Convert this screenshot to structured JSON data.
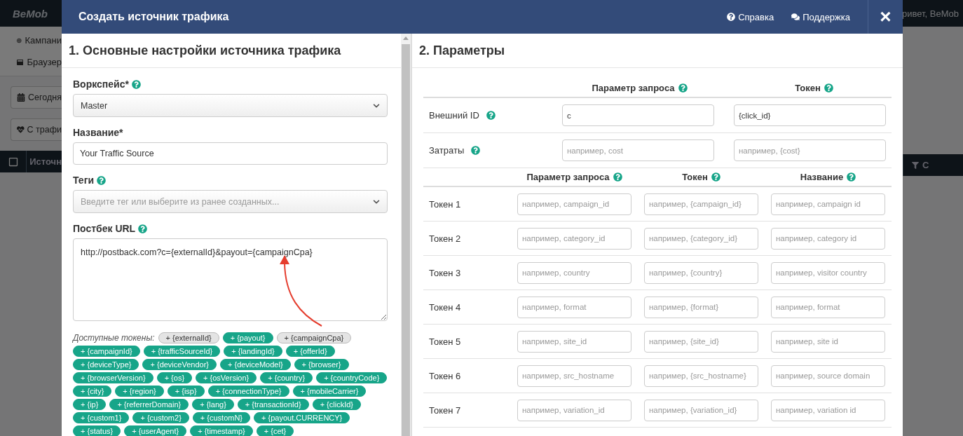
{
  "background": {
    "logo": "BeMob",
    "greeting": "ривет, BeMob",
    "nav": [
      {
        "kind": "campaigns",
        "label": "Кампани"
      },
      {
        "kind": "browser",
        "label": "Браузер"
      }
    ],
    "filters": [
      {
        "kind": "date",
        "label": "Сегодня"
      },
      {
        "kind": "traffic",
        "label": "С трафи"
      }
    ],
    "table_header": {
      "column_1": "Источн",
      "column_2": "C"
    }
  },
  "modal": {
    "title": "Создать источник трафика",
    "links": [
      {
        "kind": "help",
        "label": "Справка"
      },
      {
        "kind": "support",
        "label": "Поддержка"
      }
    ],
    "close": "×"
  },
  "section_1": {
    "heading": "1. Основные настройки источника трафика",
    "workspace": {
      "label": "Воркспейс*",
      "value": "Master"
    },
    "name": {
      "label": "Название*",
      "value": "Your Traffic Source"
    },
    "tags": {
      "label": "Теги",
      "placeholder": "Введите тег или выберите из ранее созданных..."
    },
    "postback": {
      "label": "Постбек URL",
      "value": "http://postback.com?c={externalId}&payout={campaignCpa}"
    },
    "tokens_label": "Доступные токены:",
    "tokens": [
      {
        "label": "+ {externalId}",
        "used": true
      },
      {
        "label": "+ {payout}",
        "used": false
      },
      {
        "label": "+ {campaignCpa}",
        "used": true
      },
      {
        "label": "+ {campaignId}",
        "used": false
      },
      {
        "label": "+ {trafficSourceId}",
        "used": false
      },
      {
        "label": "+ {landingId}",
        "used": false
      },
      {
        "label": "+ {offerId}",
        "used": false
      },
      {
        "label": "+ {deviceType}",
        "used": false
      },
      {
        "label": "+ {deviceVendor}",
        "used": false
      },
      {
        "label": "+ {deviceModel}",
        "used": false
      },
      {
        "label": "+ {browser}",
        "used": false
      },
      {
        "label": "+ {browserVersion}",
        "used": false
      },
      {
        "label": "+ {os}",
        "used": false
      },
      {
        "label": "+ {osVersion}",
        "used": false
      },
      {
        "label": "+ {country}",
        "used": false
      },
      {
        "label": "+ {countryCode}",
        "used": false
      },
      {
        "label": "+ {city}",
        "used": false
      },
      {
        "label": "+ {region}",
        "used": false
      },
      {
        "label": "+ {isp}",
        "used": false
      },
      {
        "label": "+ {connectionType}",
        "used": false
      },
      {
        "label": "+ {mobileCarrier}",
        "used": false
      },
      {
        "label": "+ {ip}",
        "used": false
      },
      {
        "label": "+ {referrerDomain}",
        "used": false
      },
      {
        "label": "+ {lang}",
        "used": false
      },
      {
        "label": "+ {transactionId}",
        "used": false
      },
      {
        "label": "+ {clickId}",
        "used": false
      },
      {
        "label": "+ {custom1}",
        "used": false
      },
      {
        "label": "+ {custom2}",
        "used": false
      },
      {
        "label": "+ {customN}",
        "used": false
      },
      {
        "label": "+ {payout.CURRENCY}",
        "used": false
      },
      {
        "label": "+ {status}",
        "used": false
      },
      {
        "label": "+ {userAgent}",
        "used": false
      },
      {
        "label": "+ {timestamp}",
        "used": false
      },
      {
        "label": "+ {cet}",
        "used": false
      }
    ]
  },
  "section_2": {
    "heading": "2. Параметры",
    "main_columns": [
      "Параметр запроса",
      "Токен"
    ],
    "main_rows": [
      {
        "label": "Внешний ID",
        "param": {
          "value": "c"
        },
        "token": {
          "value": "{click_id}"
        }
      },
      {
        "label": "Затраты",
        "param": {
          "placeholder": "например, cost"
        },
        "token": {
          "placeholder": "например, {cost}"
        }
      }
    ],
    "token_columns": [
      "Параметр запроса",
      "Токен",
      "Название"
    ],
    "token_rows": [
      {
        "label": "Токен 1",
        "param": {
          "placeholder": "например, campaign_id"
        },
        "token": {
          "placeholder": "например, {campaign_id}"
        },
        "name": {
          "placeholder": "например, campaign id"
        }
      },
      {
        "label": "Токен 2",
        "param": {
          "placeholder": "например, category_id"
        },
        "token": {
          "placeholder": "например, {category_id}"
        },
        "name": {
          "placeholder": "например, category id"
        }
      },
      {
        "label": "Токен 3",
        "param": {
          "placeholder": "например, country"
        },
        "token": {
          "placeholder": "например, {country}"
        },
        "name": {
          "placeholder": "например, visitor country"
        }
      },
      {
        "label": "Токен 4",
        "param": {
          "placeholder": "например, format"
        },
        "token": {
          "placeholder": "например, {format}"
        },
        "name": {
          "placeholder": "например, format"
        }
      },
      {
        "label": "Токен 5",
        "param": {
          "placeholder": "например, site_id"
        },
        "token": {
          "placeholder": "например, {site_id}"
        },
        "name": {
          "placeholder": "например, site id"
        }
      },
      {
        "label": "Токен 6",
        "param": {
          "placeholder": "например, src_hostname"
        },
        "token": {
          "placeholder": "например, {src_hostname}"
        },
        "name": {
          "placeholder": "например, source domain"
        }
      },
      {
        "label": "Токен 7",
        "param": {
          "placeholder": "например, variation_id"
        },
        "token": {
          "placeholder": "например, {variation_id}"
        },
        "name": {
          "placeholder": "например, variation id"
        }
      }
    ]
  }
}
